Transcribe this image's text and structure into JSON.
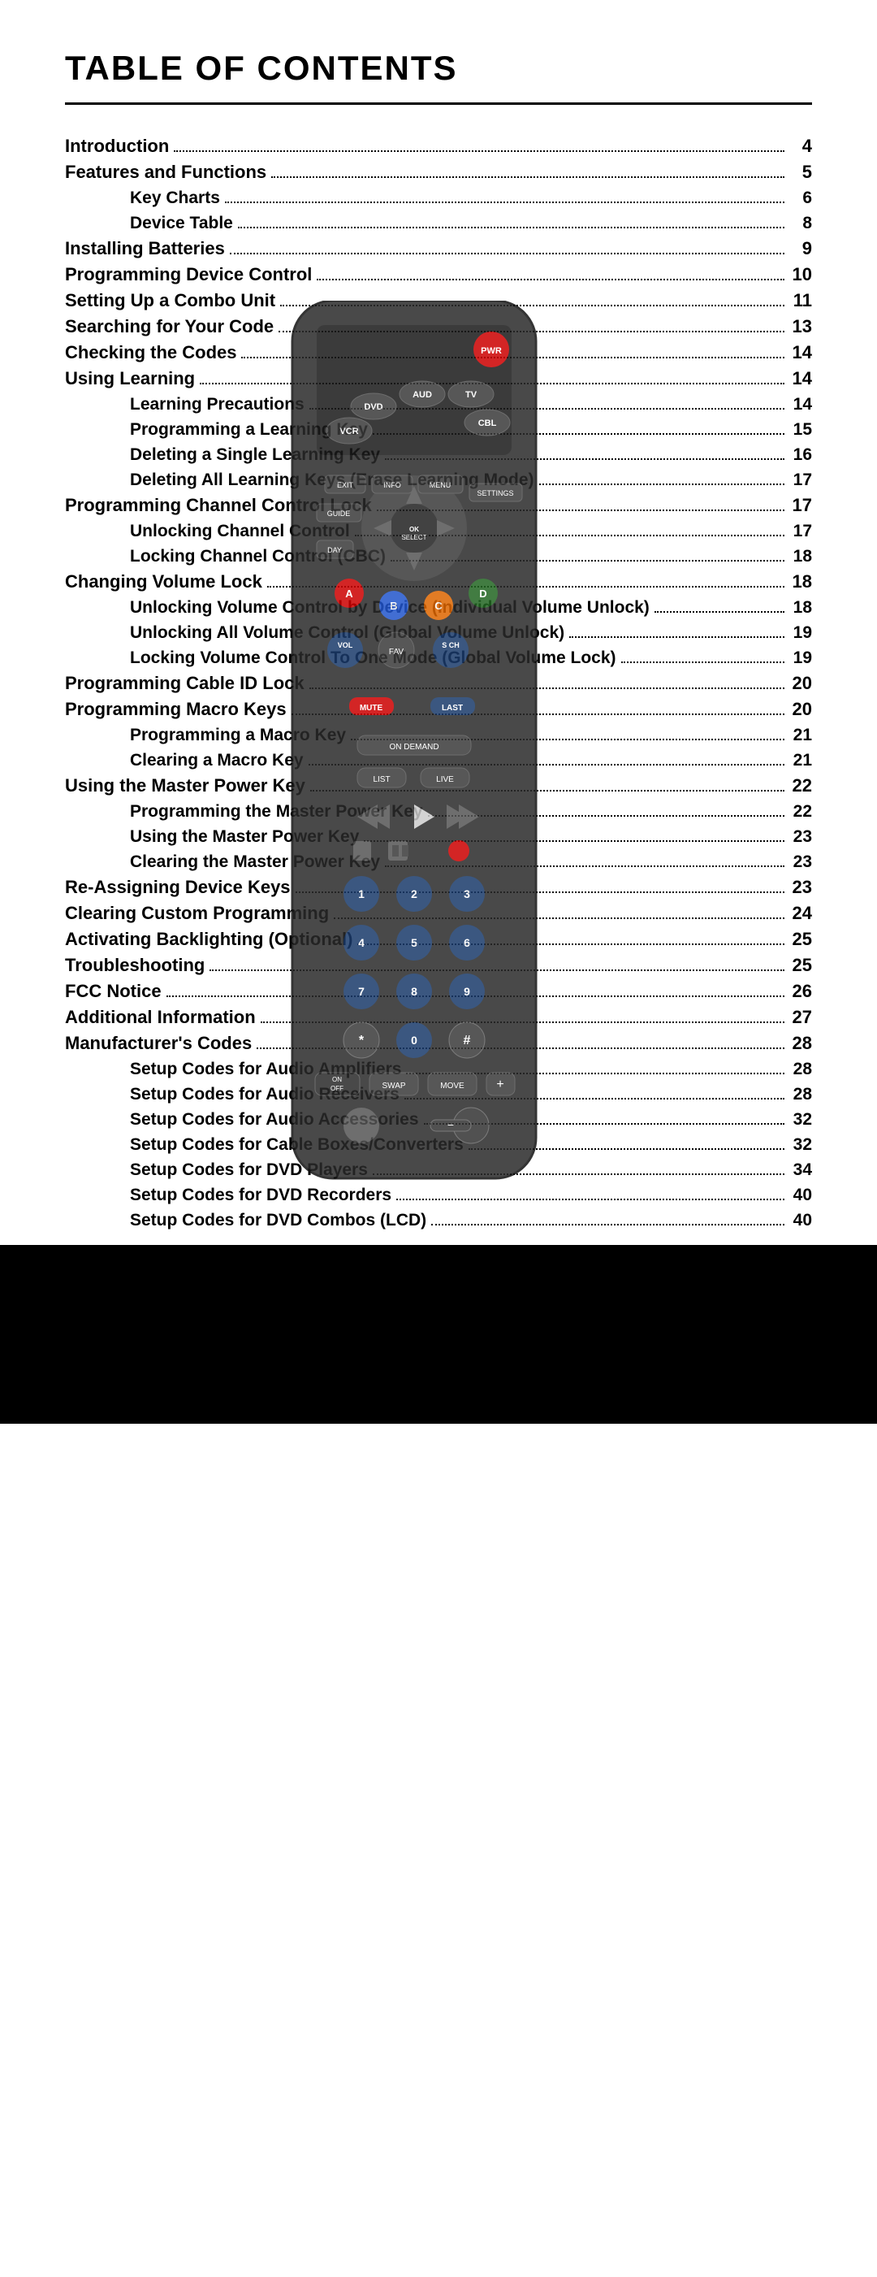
{
  "title": "TABLE OF CONTENTS",
  "entries": [
    {
      "label": "Introduction",
      "dots": true,
      "page": "4",
      "level": 0
    },
    {
      "label": "Features and Functions",
      "dots": true,
      "page": "5",
      "level": 0
    },
    {
      "label": "Key Charts",
      "dots": true,
      "page": "6",
      "level": 1
    },
    {
      "label": "Device Table",
      "dots": true,
      "page": "8",
      "level": 1
    },
    {
      "label": "Installing Batteries",
      "dots": true,
      "page": "9",
      "level": 0
    },
    {
      "label": "Programming Device Control",
      "dots": true,
      "page": "10",
      "level": 0
    },
    {
      "label": "Setting Up a Combo Unit",
      "dots": true,
      "page": "11",
      "level": 0
    },
    {
      "label": "Searching for Your Code",
      "dots": true,
      "page": "13",
      "level": 0
    },
    {
      "label": "Checking the Codes",
      "dots": true,
      "page": "14",
      "level": 0
    },
    {
      "label": "Using Learning",
      "dots": true,
      "page": "14",
      "level": 0
    },
    {
      "label": "Learning Precautions",
      "dots": true,
      "page": "14",
      "level": 1
    },
    {
      "label": "Programming a Learning Key",
      "dots": true,
      "page": "15",
      "level": 1
    },
    {
      "label": "Deleting a Single Learning Key",
      "dots": true,
      "page": "16",
      "level": 1
    },
    {
      "label": "Deleting All Learning Keys (Erase Learning Mode)",
      "dots": true,
      "page": "17",
      "level": 1
    },
    {
      "label": "Programming Channel Control Lock",
      "dots": true,
      "page": "17",
      "level": 0
    },
    {
      "label": "Unlocking Channel Control",
      "dots": true,
      "page": "17",
      "level": 1
    },
    {
      "label": "Locking Channel Control (CBC)",
      "dots": true,
      "page": "18",
      "level": 1
    },
    {
      "label": "Changing Volume Lock",
      "dots": true,
      "page": "18",
      "level": 0
    },
    {
      "label": "Unlocking Volume Control by Device (Individual Volume Unlock)",
      "dots": true,
      "page": "18",
      "level": 1
    },
    {
      "label": "Unlocking All Volume Control (Global Volume Unlock)",
      "dots": true,
      "page": "19",
      "level": 1
    },
    {
      "label": "Locking Volume Control To One Mode (Global Volume Lock)",
      "dots": true,
      "page": "19",
      "level": 1
    },
    {
      "label": "Programming Cable ID Lock",
      "dots": true,
      "page": "20",
      "level": 0
    },
    {
      "label": "Programming Macro Keys",
      "dots": true,
      "page": "20",
      "level": 0
    },
    {
      "label": "Programming a Macro Key",
      "dots": true,
      "page": "21",
      "level": 1
    },
    {
      "label": "Clearing a Macro Key",
      "dots": true,
      "page": "21",
      "level": 1
    },
    {
      "label": "Using the Master Power Key",
      "dots": true,
      "page": "22",
      "level": 0
    },
    {
      "label": "Programming the Master Power Key",
      "dots": true,
      "page": "22",
      "level": 1
    },
    {
      "label": "Using the Master Power Key",
      "dots": true,
      "page": "23",
      "level": 1
    },
    {
      "label": "Clearing the Master Power Key",
      "dots": true,
      "page": "23",
      "level": 1
    },
    {
      "label": "Re-Assigning Device Keys",
      "dots": true,
      "page": "23",
      "level": 0
    },
    {
      "label": "Clearing Custom Programming",
      "dots": true,
      "page": "24",
      "level": 0
    },
    {
      "label": "Activating Backlighting (Optional)",
      "dots": true,
      "page": "25",
      "level": 0
    },
    {
      "label": "Troubleshooting",
      "dots": true,
      "page": "25",
      "level": 0
    },
    {
      "label": "FCC Notice",
      "dots": true,
      "page": "26",
      "level": 0
    },
    {
      "label": "Additional Information",
      "dots": true,
      "page": "27",
      "level": 0
    },
    {
      "label": "Manufacturer's Codes",
      "dots": true,
      "page": "28",
      "level": 0
    },
    {
      "label": "Setup Codes for Audio Amplifiers",
      "dots": true,
      "page": "28",
      "level": 1
    },
    {
      "label": "Setup Codes for Audio Receivers",
      "dots": true,
      "page": "28",
      "level": 1
    },
    {
      "label": "Setup Codes for Audio Accessories",
      "dots": true,
      "page": "32",
      "level": 1
    },
    {
      "label": "Setup Codes for Cable Boxes/Converters",
      "dots": true,
      "page": "32",
      "level": 1
    },
    {
      "label": "Setup Codes for DVD Players",
      "dots": true,
      "page": "34",
      "level": 1
    },
    {
      "label": "Setup Codes for DVD Recorders",
      "dots": true,
      "page": "40",
      "level": 1
    },
    {
      "label": "Setup Codes for DVD Combos (LCD)",
      "dots": true,
      "page": "40",
      "level": 1
    }
  ]
}
